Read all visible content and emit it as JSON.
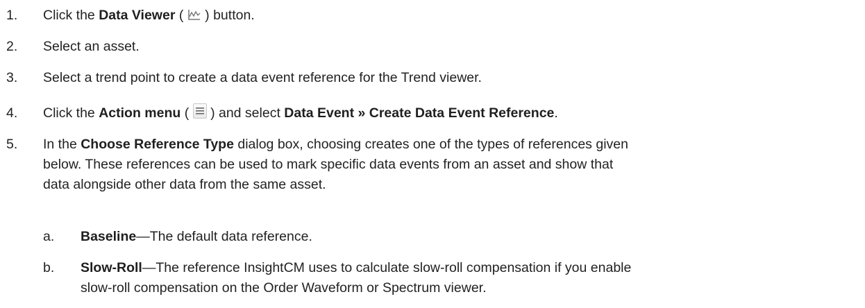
{
  "steps": [
    {
      "num": "1.",
      "pre": "Click the ",
      "bold": "Data Viewer",
      "mid": " (",
      "icon": "data-viewer-icon",
      "post": ") button."
    },
    {
      "num": "2.",
      "text": "Select an asset."
    },
    {
      "num": "3.",
      "text": "Select a trend point to create a data event reference for the Trend viewer."
    },
    {
      "num": "4.",
      "pre": "Click the ",
      "bold": "Action menu",
      "mid": " (",
      "icon": "action-menu-icon",
      "post": ") and select ",
      "bold2": "Data Event » Create Data Event Reference",
      "end": "."
    },
    {
      "num": "5.",
      "pre": "In the ",
      "bold": "Choose Reference Type",
      "line1_rest": " dialog box, choosing creates one of the types of references given",
      "line2": "below. These references can be used to mark specific data events from an asset and show that",
      "line3": "data alongside other data from the same asset."
    }
  ],
  "substeps": [
    {
      "num": "a.",
      "bold": "Baseline",
      "rest": "—The default data reference."
    },
    {
      "num": "b.",
      "bold": "Slow-Roll",
      "rest": "—The reference InsightCM uses to calculate slow-roll compensation if you enable",
      "line2": "slow-roll compensation on the Order Waveform or Spectrum viewer."
    }
  ]
}
